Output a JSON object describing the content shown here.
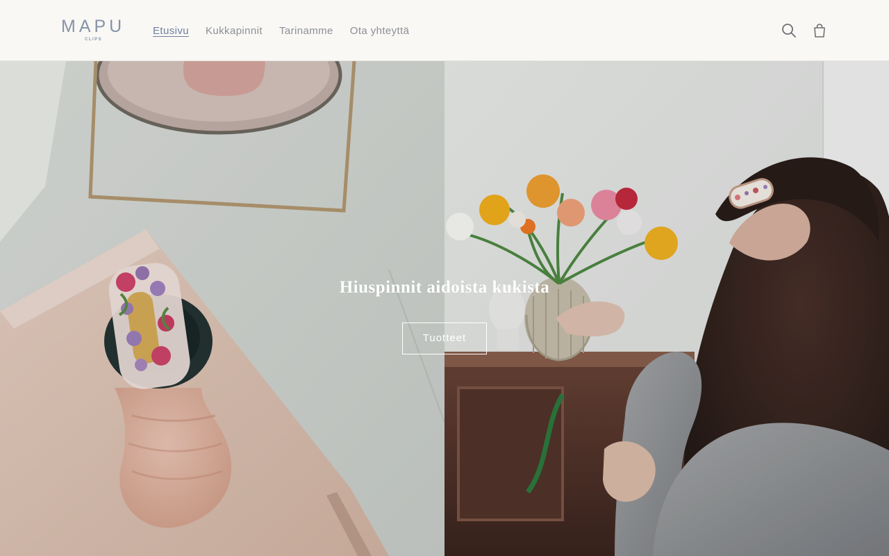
{
  "header": {
    "logo": {
      "main": "MAPU",
      "sub": "CLIPS"
    },
    "nav": [
      {
        "label": "Etusivu",
        "active": true
      },
      {
        "label": "Kukkapinnit",
        "active": false
      },
      {
        "label": "Tarinamme",
        "active": false
      },
      {
        "label": "Ota yhteyttä",
        "active": false
      }
    ],
    "icons": {
      "search": "search-icon",
      "cart": "cart-icon"
    }
  },
  "hero": {
    "title": "Hiuspinnit aidoista kukista",
    "button_label": "Tuotteet"
  },
  "colors": {
    "header_bg": "#f9f8f4",
    "logo": "#8693a8",
    "nav_text": "#8c8f98",
    "nav_active": "#6f7ea1",
    "hero_text": "#ffffff"
  }
}
